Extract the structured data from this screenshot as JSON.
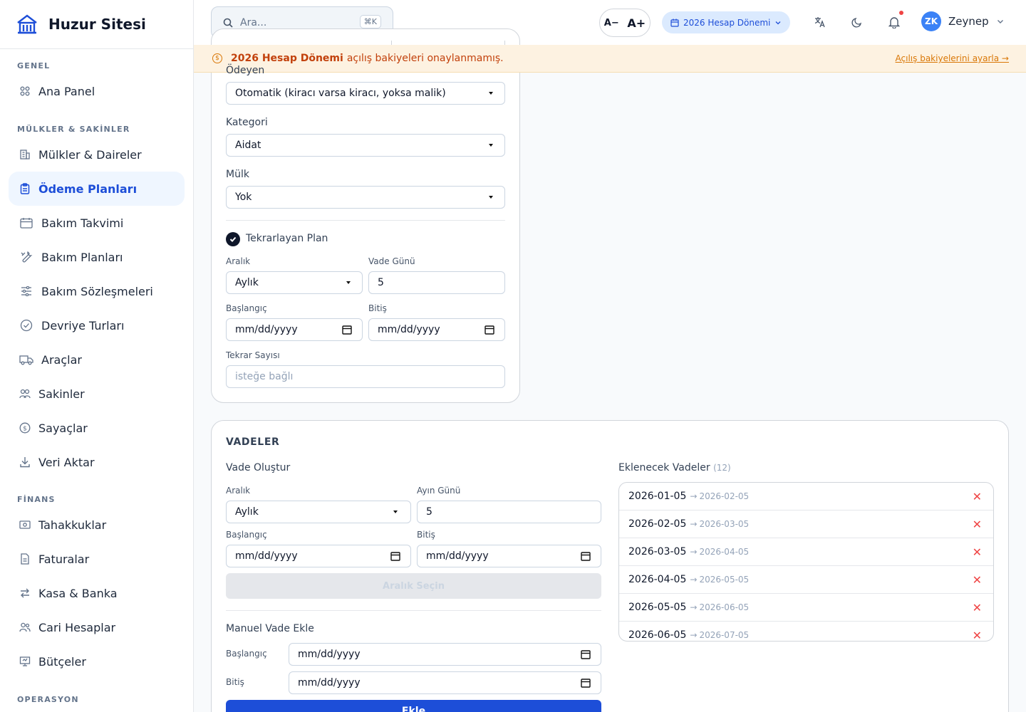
{
  "brand": {
    "name": "Huzur Sitesi"
  },
  "sidebar": {
    "sections": [
      {
        "label": "GENEL"
      },
      {
        "label": "MÜLKLER & SAKİNLER"
      },
      {
        "label": "FİNANS"
      },
      {
        "label": "OPERASYON"
      }
    ],
    "items": [
      {
        "label": "Ana Panel",
        "icon": "grid-icon"
      },
      {
        "label": "Mülkler & Daireler",
        "icon": "building-icon"
      },
      {
        "label": "Ödeme Planları",
        "icon": "clipboard-icon",
        "active": true
      },
      {
        "label": "Bakım Takvimi",
        "icon": "calendar-icon"
      },
      {
        "label": "Bakım Planları",
        "icon": "wrench-icon"
      },
      {
        "label": "Bakım Sözleşmeleri",
        "icon": "sliders-icon"
      },
      {
        "label": "Devriye Turları",
        "icon": "check-circle-icon"
      },
      {
        "label": "Araçlar",
        "icon": "truck-icon"
      },
      {
        "label": "Sakinler",
        "icon": "people-icon"
      },
      {
        "label": "Sayaçlar",
        "icon": "dollar-circle-icon"
      },
      {
        "label": "Veri Aktar",
        "icon": "download-icon"
      },
      {
        "label": "Tahakkuklar",
        "icon": "banknote-icon"
      },
      {
        "label": "Faturalar",
        "icon": "invoice-icon"
      },
      {
        "label": "Kasa & Banka",
        "icon": "transfer-icon"
      },
      {
        "label": "Cari Hesaplar",
        "icon": "users-icon"
      },
      {
        "label": "Bütçeler",
        "icon": "presentation-icon"
      }
    ]
  },
  "topbar": {
    "search_placeholder": "Ara...",
    "search_shortcut": "⌘K",
    "font_decrease": "A−",
    "font_increase": "A+",
    "period": "2026 Hesap Dönemi",
    "user_initials": "ZK",
    "user_name": "Zeynep"
  },
  "banner": {
    "bold": "2026 Hesap Dönemi",
    "text": "açılış bakiyeleri onaylanmamış.",
    "link": "Açılış bakiyelerini ayarla →"
  },
  "form": {
    "payer_label": "Ödeyen",
    "payer_value": "Otomatik (kiracı varsa kiracı, yoksa malik)",
    "category_label": "Kategori",
    "category_value": "Aidat",
    "property_label": "Mülk",
    "property_value": "Yok",
    "recurring_label": "Tekrarlayan Plan",
    "recurring_checked": true,
    "interval_label": "Aralık",
    "interval_value": "Aylık",
    "due_day_label": "Vade Günü",
    "due_day_value": "5",
    "start_label": "Başlangıç",
    "start_value": "mm/dd/yyyy",
    "end_label": "Bitiş",
    "end_value": "mm/dd/yyyy",
    "repeat_label": "Tekrar Sayısı",
    "repeat_placeholder": "isteğe bağlı"
  },
  "vadeler": {
    "title": "VADELER",
    "create_title": "Vade Oluştur",
    "interval_label": "Aralık",
    "interval_value": "Aylık",
    "month_day_label": "Ayın Günü",
    "month_day_value": "5",
    "start_label": "Başlangıç",
    "start_value": "mm/dd/yyyy",
    "end_label": "Bitiş",
    "end_value": "mm/dd/yyyy",
    "select_range_button": "Aralık Seçin",
    "manual_title": "Manuel Vade Ekle",
    "manual_start_label": "Başlangıç",
    "manual_start_value": "mm/dd/yyyy",
    "manual_end_label": "Bitiş",
    "manual_end_value": "mm/dd/yyyy",
    "add_button": "Ekle",
    "list_title": "Eklenecek Vadeler",
    "list_count": "(12)",
    "list": [
      {
        "start": "2026-01-05",
        "arrow": "→",
        "end": "2026-02-05"
      },
      {
        "start": "2026-02-05",
        "arrow": "→",
        "end": "2026-03-05"
      },
      {
        "start": "2026-03-05",
        "arrow": "→",
        "end": "2026-04-05"
      },
      {
        "start": "2026-04-05",
        "arrow": "→",
        "end": "2026-05-05"
      },
      {
        "start": "2026-05-05",
        "arrow": "→",
        "end": "2026-06-05"
      },
      {
        "start": "2026-06-05",
        "arrow": "→",
        "end": "2026-07-05"
      }
    ]
  }
}
